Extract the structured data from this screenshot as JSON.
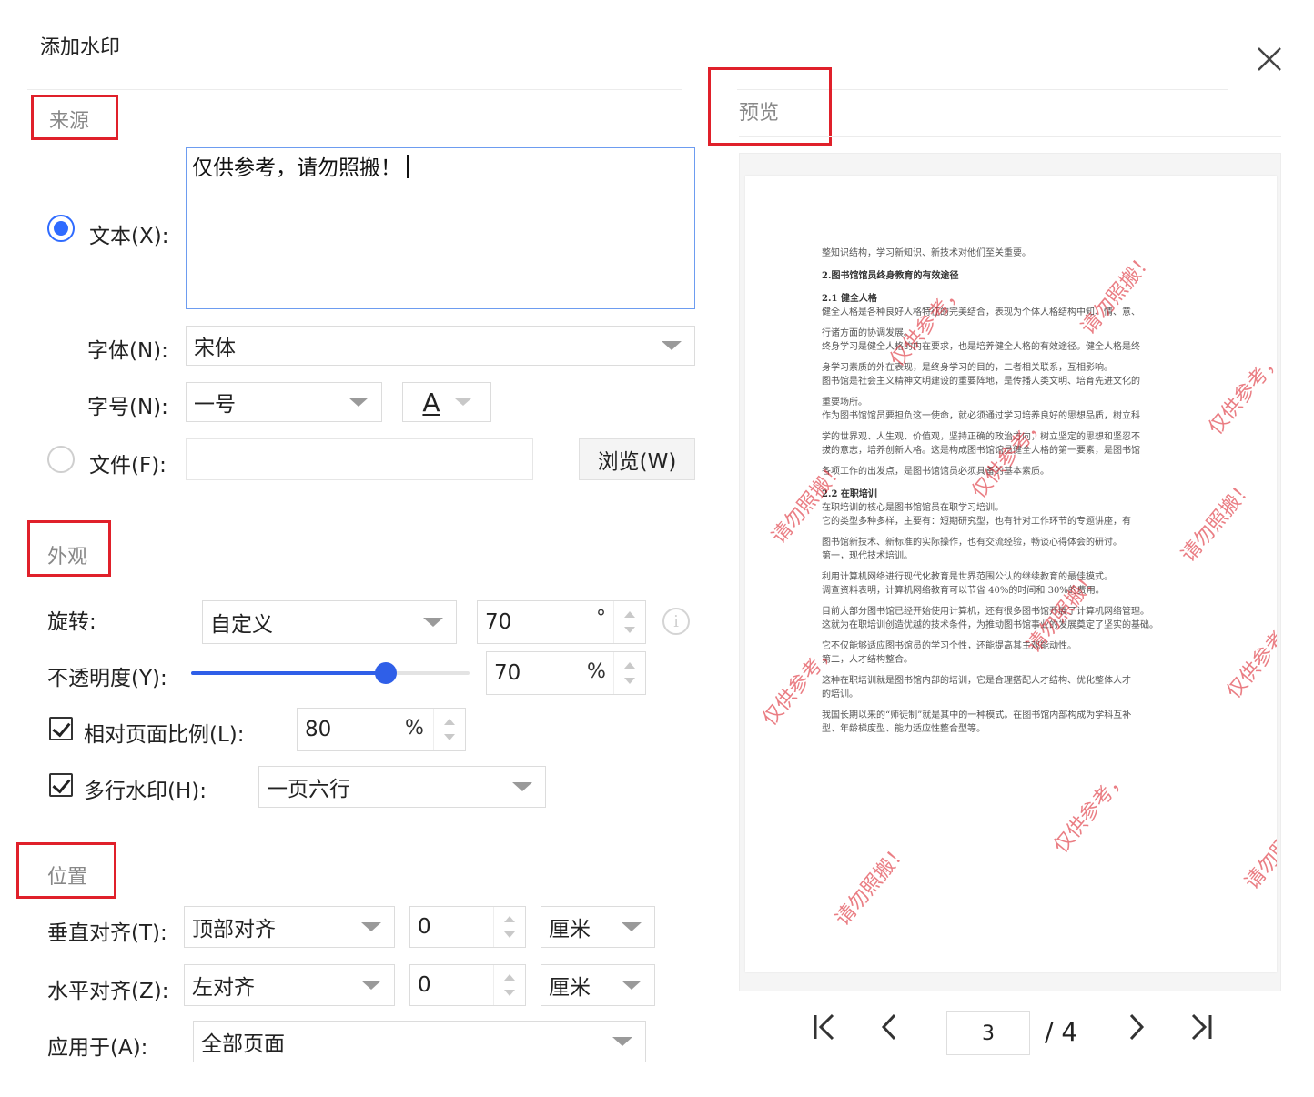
{
  "dialog": {
    "title": "添加水印",
    "close_icon": "close-icon"
  },
  "source": {
    "section_label": "来源",
    "text_label": "文本(X):",
    "text_value": "仅供参考，请勿照搬！",
    "text_selected": true,
    "font_label": "字体(N):",
    "font_value": "宋体",
    "size_label": "字号(N):",
    "size_value": "一号",
    "font_color_glyph": "A",
    "file_label": "文件(F):",
    "file_value": "",
    "browse_label": "浏览(W)"
  },
  "appearance": {
    "section_label": "外观",
    "rotation_label": "旋转:",
    "rotation_mode": "自定义",
    "rotation_value": "70",
    "rotation_unit": "°",
    "info_glyph": "i",
    "opacity_label": "不透明度(Y):",
    "opacity_value": "70",
    "opacity_unit": "%",
    "opacity_fraction": 0.7,
    "scale_label": "相对页面比例(L):",
    "scale_checked": true,
    "scale_value": "80",
    "scale_unit": "%",
    "multiline_label": "多行水印(H):",
    "multiline_checked": true,
    "multiline_value": "一页六行"
  },
  "position": {
    "section_label": "位置",
    "vertical_label": "垂直对齐(T):",
    "vertical_value": "顶部对齐",
    "vertical_offset": "0",
    "vertical_unit": "厘米",
    "horizontal_label": "水平对齐(Z):",
    "horizontal_value": "左对齐",
    "horizontal_offset": "0",
    "horizontal_unit": "厘米",
    "apply_label": "应用于(A):",
    "apply_value": "全部页面"
  },
  "preview": {
    "section_label": "预览",
    "watermark_texts": [
      "仅供参考，",
      "请勿照搬！",
      "仅供参考，",
      "请勿照搬！",
      "仅供参考，",
      "请勿照搬！",
      "仅供参考，",
      "请勿照搬！",
      "仅供参考，",
      "请勿照搬！",
      "仅供参考，",
      "请勿照搬！"
    ],
    "doc_lines": [
      {
        "t": "整知识结构，学习新知识、新技术对他们至关重要。",
        "h": false
      },
      {
        "t": "2.图书馆馆员终身教育的有效途径",
        "h": true
      },
      {
        "t": "2.1 健全人格",
        "h": true
      },
      {
        "t": "健全人格是各种良好人格特征的完美结合，表现为个体人格结构中知、情、意、",
        "h": false
      },
      {
        "t": "行诸方面的协调发展。",
        "h": false
      },
      {
        "t": "终身学习是健全人格的内在要求，也是培养健全人格的有效途径。健全人格是终",
        "h": false
      },
      {
        "t": "身学习素质的外在表现，是终身学习的目的，二者相关联系，互相影响。",
        "h": false
      },
      {
        "t": "图书馆是社会主义精神文明建设的重要阵地，是传播人类文明、培育先进文化的",
        "h": false
      },
      {
        "t": "重要场所。",
        "h": false
      },
      {
        "t": "作为图书馆馆员要担负这一使命，就必须通过学习培养良好的思想品质，树立科",
        "h": false
      },
      {
        "t": "学的世界观、人生观、价值观，坚持正确的政治方向，树立坚定的思想和坚忍不",
        "h": false
      },
      {
        "t": "拔的意志，培养创新人格。这是构成图书馆馆员健全人格的第一要素，是图书馆",
        "h": false
      },
      {
        "t": "各项工作的出发点，是图书馆馆员必须具备的基本素质。",
        "h": false
      },
      {
        "t": "2.2 在职培训",
        "h": true
      },
      {
        "t": "在职培训的核心是图书馆馆员在职学习培训。",
        "h": false
      },
      {
        "t": "它的类型多种多样，主要有：短期研究型，也有针对工作环节的专题讲座，有",
        "h": false
      },
      {
        "t": "图书馆新技术、新标准的实际操作，也有交流经验，畅谈心得体会的研讨。",
        "h": false
      },
      {
        "t": "第一，现代技术培训。",
        "h": false
      },
      {
        "t": "利用计算机网络进行现代化教育是世界范围公认的继续教育的最佳模式。",
        "h": false
      },
      {
        "t": "调查资料表明，计算机网络教育可以节省 40%的时间和 30%的费用。",
        "h": false
      },
      {
        "t": "目前大部分图书馆已经开始使用计算机，还有很多图书馆开展了计算机网络管理。",
        "h": false
      },
      {
        "t": "这就为在职培训创造优越的技术条件，为推动图书馆事业的发展奠定了坚实的基础。",
        "h": false
      },
      {
        "t": "它不仅能够适应图书馆员的学习个性，还能提高其主观能动性。",
        "h": false
      },
      {
        "t": "第二，人才结构整合。",
        "h": false
      },
      {
        "t": "这种在职培训就是图书馆内部的培训，它是合理搭配人才结构、优化整体人才",
        "h": false
      },
      {
        "t": "的培训。",
        "h": false
      },
      {
        "t": "我国长期以来的“师徒制”就是其中的一种模式。在图书馆内部构成为学科互补",
        "h": false
      },
      {
        "t": "型、年龄梯度型、能力适应性整合型等。",
        "h": false
      }
    ],
    "current_page": "3",
    "total_pages": "/ 4",
    "first_icon": "first-page-icon",
    "prev_icon": "prev-page-icon",
    "next_icon": "next-page-icon",
    "last_icon": "last-page-icon"
  },
  "colors": {
    "accent": "#2f6bff",
    "annotation_red": "#e0202a",
    "watermark_red": "#dc2832"
  }
}
